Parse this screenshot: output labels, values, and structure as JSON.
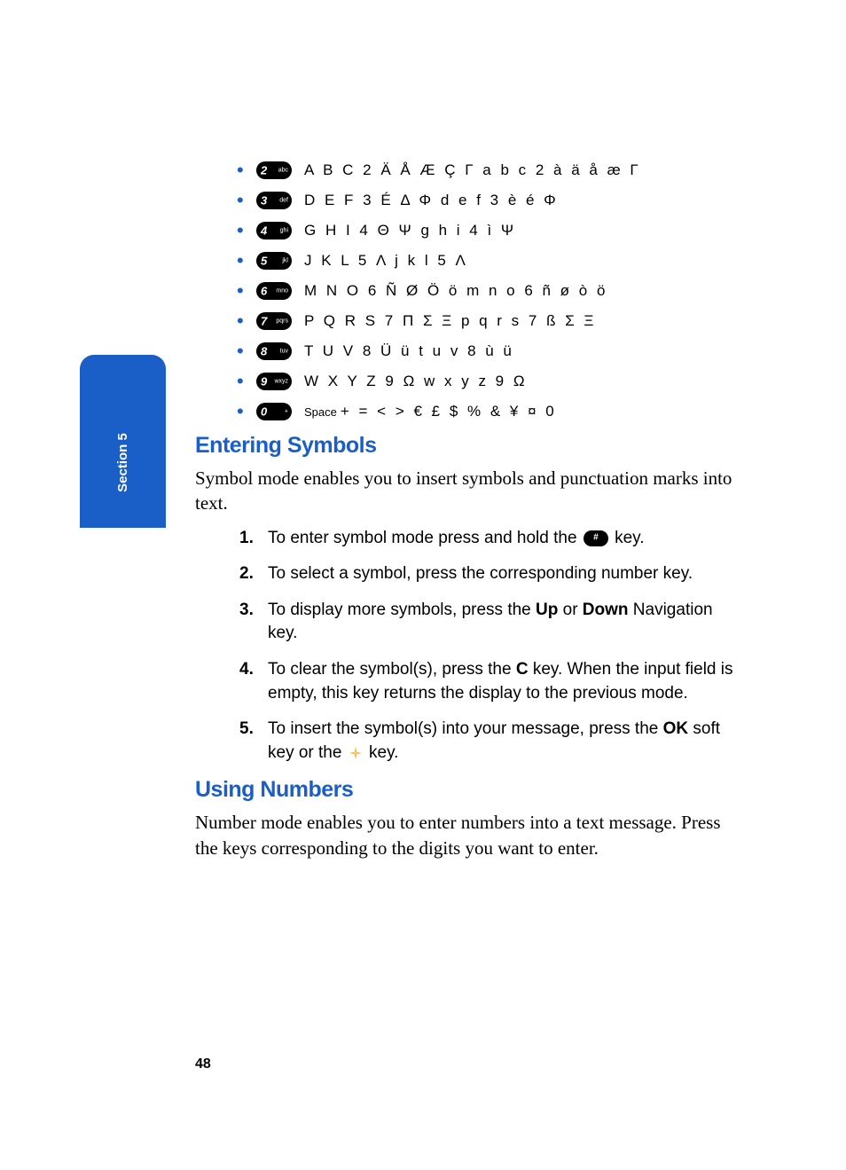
{
  "section_tab": "Section 5",
  "keys": [
    {
      "num": "2",
      "lbl": "abc",
      "chars": "A B C 2 Ä Å Æ Ç Γ a b c 2 à ä å æ Γ"
    },
    {
      "num": "3",
      "lbl": "def",
      "chars": "D E F 3 É Δ Φ d e f 3 è é Φ"
    },
    {
      "num": "4",
      "lbl": "ghi",
      "chars": "G H I 4 Θ Ψ g h i 4 ì Ψ"
    },
    {
      "num": "5",
      "lbl": "jkl",
      "chars": "J K L 5 Λ j k l 5 Λ"
    },
    {
      "num": "6",
      "lbl": "mno",
      "chars": "M N O 6 Ñ Ø Ö ö m n o 6 ñ ø ò ö"
    },
    {
      "num": "7",
      "lbl": "pqrs",
      "chars": "P Q R S 7 Π Σ Ξ p q r s 7 ß Σ Ξ"
    },
    {
      "num": "8",
      "lbl": "tuv",
      "chars": "T U V 8 Ü ü t u v 8 ù ü"
    },
    {
      "num": "9",
      "lbl": "wxyz",
      "chars": "W X Y Z 9 Ω w x y z 9 Ω"
    },
    {
      "num": "0",
      "lbl": "+",
      "space_word": "Space",
      "chars": "+ = < > € £ $ % & ¥ ¤ 0"
    }
  ],
  "heading1": "Entering Symbols",
  "para1": "Symbol mode enables you to insert symbols and punctuation marks into text.",
  "steps": {
    "s1a": "To enter symbol mode press and hold the ",
    "s1b": " key.",
    "hash_key": "#",
    "s2": "To select a symbol, press the corresponding number key.",
    "s3a": "To display more symbols, press the ",
    "up": "Up",
    "or": " or ",
    "down": "Down",
    "s3b": " Navigation key.",
    "s4a": "To clear the symbol(s), press the ",
    "c": "C",
    "s4b": " key. When the input field is empty, this key returns the display to the previous mode.",
    "s5a": "To insert the symbol(s) into your message, press the ",
    "ok": "OK",
    "s5b": " soft key or the ",
    "s5c": " key."
  },
  "heading2": "Using Numbers",
  "para2": "Number mode enables you to enter numbers into a text message. Press the keys corresponding to the digits you want to enter.",
  "page_number": "48"
}
